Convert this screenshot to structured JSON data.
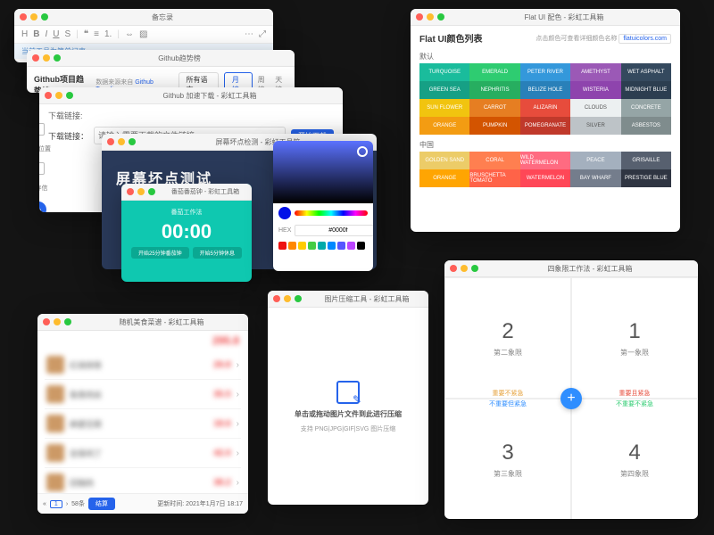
{
  "app_suffix": "彩虹工具箱",
  "traffic": {
    "red": "#ff5f57",
    "amber": "#febc2e",
    "green": "#28c840"
  },
  "notes": {
    "title": "备忘录",
    "status": "当前工具为简单记事…"
  },
  "trending": {
    "title": "Github趋势榜",
    "subtitle": "Github项目趋势榜",
    "source_prefix": "数据来源来自",
    "source_link": "Github Trending",
    "select": "所有语言",
    "seg": [
      "月榜",
      "周榜",
      "天榜"
    ]
  },
  "accel": {
    "title": "Github 加速下载 - 彩虹工具箱",
    "label": "下载链接:",
    "field_label": "下载链接：",
    "placeholder": "请输入需要下载的文件链接",
    "button": "开始下载",
    "sidebar": [
      "保存位置",
      "保存信"
    ]
  },
  "pixel": {
    "title": "屏幕坏点检测 - 彩虹工具箱",
    "heading": "屏幕坏点测试"
  },
  "pomodoro": {
    "title": "番茄番茄钟 - 彩虹工具箱",
    "label": "番茄工作法",
    "time": "00:00",
    "btn1": "开始25分钟番茄钟",
    "btn2": "开始5分钟休息"
  },
  "picker": {
    "hex_label": "HEX",
    "hex_value": "#0000f",
    "chips": [
      "#e11",
      "#f80",
      "#fc0",
      "#4c4",
      "#0aa",
      "#08f",
      "#55f",
      "#b4f",
      "#000"
    ]
  },
  "listwin": {
    "title": "随机美食菜谱 - 彩虹工具箱",
    "sum_badge": "295.8",
    "rows": [
      {
        "name": "红烧排骨",
        "price": "29.8"
      },
      {
        "name": "鱼香肉丝",
        "price": "35.5"
      },
      {
        "name": "麻婆豆腐",
        "price": "18.6"
      },
      {
        "name": "宫保鸡丁",
        "price": "42.0"
      },
      {
        "name": "回锅肉",
        "price": "38.2"
      }
    ],
    "footer": {
      "page": "1",
      "total": "58条",
      "submit": "结算",
      "updated": "更新时间: 2021年1月7日 18:17"
    }
  },
  "flatui": {
    "title": "Flat UI 配色 - 彩虹工具箱",
    "heading": "Flat UI颜色列表",
    "hint_prefix": "点击颜色可查看详细颜色名称",
    "hint_link": "flatuicolors.com",
    "sec1": "默认",
    "sec2": "中国",
    "rows1": [
      [
        {
          "n": "Turquoise",
          "c": "#1abc9c"
        },
        {
          "n": "Emerald",
          "c": "#2ecc71"
        },
        {
          "n": "Peter River",
          "c": "#3498db"
        },
        {
          "n": "Amethyst",
          "c": "#9b59b6"
        },
        {
          "n": "Wet Asphalt",
          "c": "#34495e"
        }
      ],
      [
        {
          "n": "Green Sea",
          "c": "#16a085"
        },
        {
          "n": "Nephritis",
          "c": "#27ae60"
        },
        {
          "n": "Belize Hole",
          "c": "#2980b9"
        },
        {
          "n": "Wisteria",
          "c": "#8e44ad"
        },
        {
          "n": "Midnight Blue",
          "c": "#2c3e50"
        }
      ],
      [
        {
          "n": "Sun Flower",
          "c": "#f1c40f"
        },
        {
          "n": "Carrot",
          "c": "#e67e22"
        },
        {
          "n": "Alizarin",
          "c": "#e74c3c"
        },
        {
          "n": "Clouds",
          "c": "#ecf0f1"
        },
        {
          "n": "Concrete",
          "c": "#95a5a6"
        }
      ],
      [
        {
          "n": "Orange",
          "c": "#f39c12"
        },
        {
          "n": "Pumpkin",
          "c": "#d35400"
        },
        {
          "n": "Pomegranate",
          "c": "#c0392b"
        },
        {
          "n": "Silver",
          "c": "#bdc3c7"
        },
        {
          "n": "Asbestos",
          "c": "#7f8c8d"
        }
      ]
    ],
    "rows2": [
      [
        {
          "n": "Golden Sand",
          "c": "#eccc68"
        },
        {
          "n": "Coral",
          "c": "#ff7f50"
        },
        {
          "n": "Wild Watermelon",
          "c": "#ff6b81"
        },
        {
          "n": "Peace",
          "c": "#a4b0be"
        },
        {
          "n": "Grisaille",
          "c": "#57606f"
        }
      ],
      [
        {
          "n": "Orange",
          "c": "#ffa502"
        },
        {
          "n": "Bruschetta Tomato",
          "c": "#ff6348"
        },
        {
          "n": "Watermelon",
          "c": "#ff4757"
        },
        {
          "n": "Bay Wharf",
          "c": "#747d8c"
        },
        {
          "n": "Prestige Blue",
          "c": "#2f3542"
        }
      ]
    ]
  },
  "compress": {
    "title": "图片压缩工具 - 彩虹工具箱",
    "line1": "单击或拖动图片文件到此进行压缩",
    "line2": "支持 PNG|JPG|GIF|SVG 图片压缩"
  },
  "quad": {
    "title": "四象限工作法 - 彩虹工具箱",
    "cells": [
      {
        "n": "2",
        "l": "第二象限"
      },
      {
        "n": "1",
        "l": "第一象限"
      },
      {
        "n": "3",
        "l": "第三象限"
      },
      {
        "n": "4",
        "l": "第四象限"
      }
    ],
    "axis_h": [
      "重要不紧急",
      "重要且紧急",
      "不重要但紧急",
      "不重要不紧急"
    ]
  }
}
